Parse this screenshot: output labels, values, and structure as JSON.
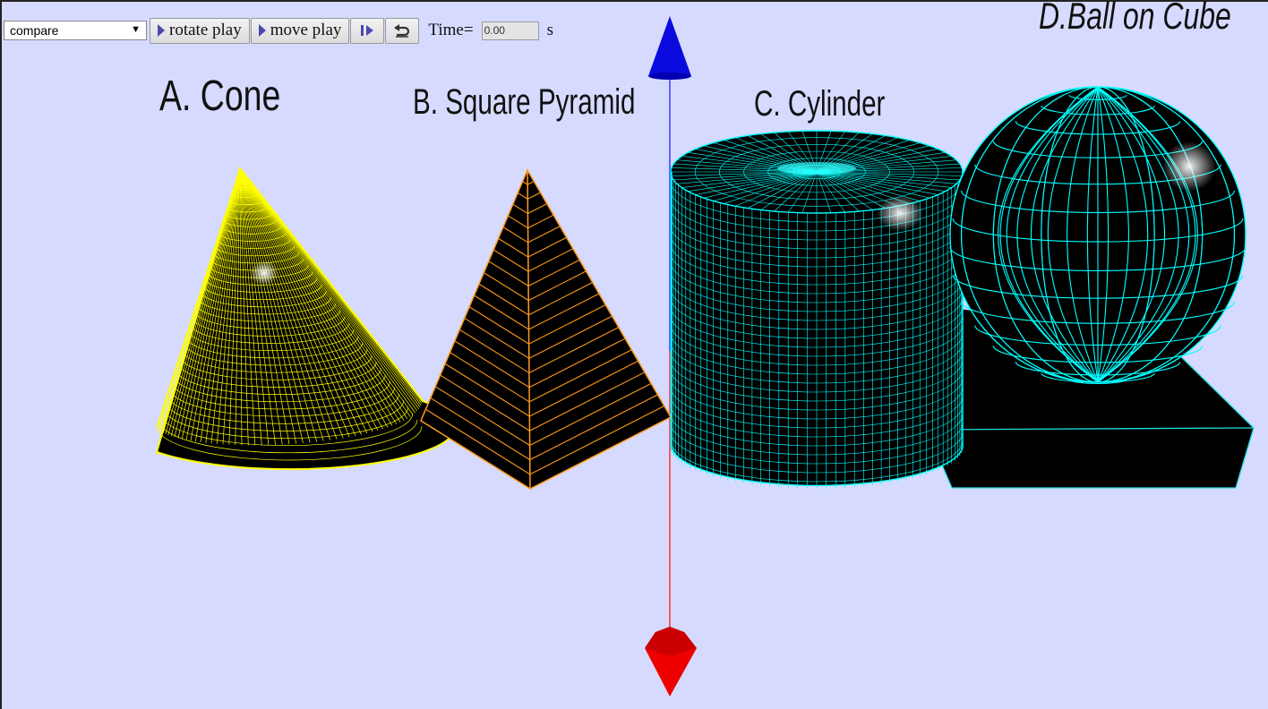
{
  "toolbar": {
    "scene_select": "compare",
    "rotate_play_label": "rotate play",
    "move_play_label": "move play",
    "step_icon": "step-forward-icon",
    "reset_icon": "undo-icon",
    "time_label": "Time=",
    "time_value": "0.00",
    "time_unit": "s"
  },
  "labels": {
    "cone": "A. Cone",
    "pyramid": "B. Square Pyramid",
    "cylinder": "C. Cylinder",
    "ball_on_cube": "D.Ball on Cube"
  },
  "colors": {
    "background": "#d6daff",
    "cone_mesh": "#ffff00",
    "pyramid_mesh": "#ff9a1a",
    "cylinder_mesh": "#00ffff",
    "axis_up": "#0000ee",
    "axis_down": "#ff0000"
  }
}
